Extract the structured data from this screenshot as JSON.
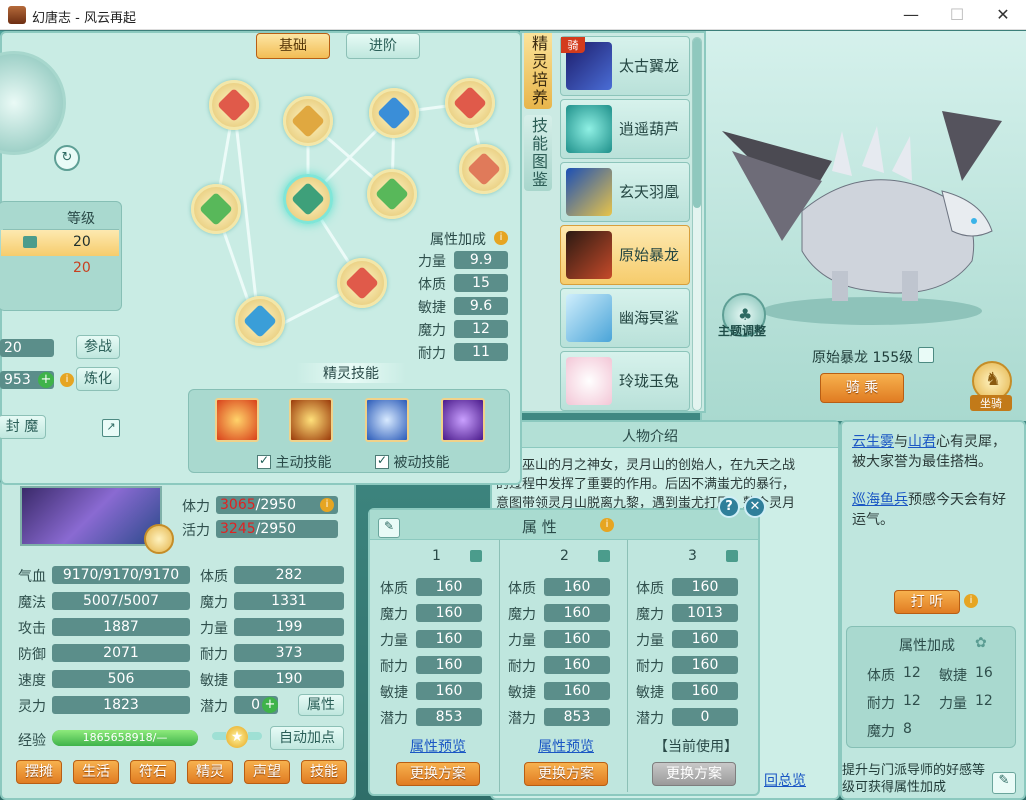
{
  "window": {
    "title": "幻唐志 - 风云再起",
    "min": "—",
    "max": "☐",
    "close": "✕"
  },
  "tabs": {
    "basic": "基础",
    "advanced": "进阶"
  },
  "vertical_tabs": {
    "spirit": "精灵培养",
    "skill_book": "技能图鉴",
    "ride_badge": "骑"
  },
  "left": {
    "level_header": "等级",
    "level_row1": "20",
    "level_row2": "20",
    "battle_value": "20",
    "battle_btn": "参战",
    "refine_value": "953",
    "refine_btn": "炼化",
    "magic_btn": "封 魔"
  },
  "spirit_attr": {
    "title": "属性加成",
    "rows": [
      {
        "label": "力量",
        "value": "9.9"
      },
      {
        "label": "体质",
        "value": "15"
      },
      {
        "label": "敏捷",
        "value": "9.6"
      },
      {
        "label": "魔力",
        "value": "12"
      },
      {
        "label": "耐力",
        "value": "11"
      }
    ]
  },
  "spirit_skills": {
    "title": "精灵技能",
    "active": "主动技能",
    "passive": "被动技能"
  },
  "pets": [
    {
      "name": "太古翼龙"
    },
    {
      "name": "逍遥葫芦"
    },
    {
      "name": "玄天羽凰"
    },
    {
      "name": "原始暴龙"
    },
    {
      "name": "幽海冥鲨"
    },
    {
      "name": "玲珑玉兔"
    }
  ],
  "mount": {
    "name_level": "原始暴龙 155级",
    "ride_btn": "骑 乘",
    "theme_btn": "主题调整",
    "mount_btn": "坐骑"
  },
  "char": {
    "stamina_label": "体力",
    "stamina_cur": "3065",
    "stamina_max": "/2950",
    "vigor_label": "活力",
    "vigor_cur": "3245",
    "vigor_max": "/2950",
    "stats_left": [
      {
        "label": "气血",
        "value": "9170/9170/9170"
      },
      {
        "label": "魔法",
        "value": "5007/5007"
      },
      {
        "label": "攻击",
        "value": "1887"
      },
      {
        "label": "防御",
        "value": "2071"
      },
      {
        "label": "速度",
        "value": "506"
      },
      {
        "label": "灵力",
        "value": "1823"
      }
    ],
    "stats_right": [
      {
        "label": "体质",
        "value": "282"
      },
      {
        "label": "魔力",
        "value": "1331"
      },
      {
        "label": "力量",
        "value": "199"
      },
      {
        "label": "耐力",
        "value": "373"
      },
      {
        "label": "敏捷",
        "value": "190"
      }
    ],
    "potential_label": "潜力",
    "potential_value": "0",
    "attr_btn": "属性",
    "exp_label": "经验",
    "exp_value": "1865658918/—",
    "exp_progress": 1.0,
    "auto_btn": "自动加点",
    "bottom_buttons": [
      "摆摊",
      "生活",
      "符石",
      "精灵",
      "声望",
      "技能"
    ]
  },
  "intro": {
    "title": "人物介绍",
    "text": "曾是巫山的月之神女，灵月山的创始人，在九天之战的过程中发挥了重要的作用。后因不满蚩尤的暴行，意图带领灵月山脱离九黎，遇到蚩尤打压，整个灵月山被迫避世……后世事。新振作"
  },
  "attr_panel": {
    "title": "属 性",
    "columns": [
      {
        "num": "1",
        "rows": [
          [
            "体质",
            "160"
          ],
          [
            "魔力",
            "160"
          ],
          [
            "力量",
            "160"
          ],
          [
            "耐力",
            "160"
          ],
          [
            "敏捷",
            "160"
          ],
          [
            "潜力",
            "853"
          ]
        ],
        "preview": "属性预览",
        "btn": "更换方案",
        "current": false
      },
      {
        "num": "2",
        "rows": [
          [
            "体质",
            "160"
          ],
          [
            "魔力",
            "160"
          ],
          [
            "力量",
            "160"
          ],
          [
            "耐力",
            "160"
          ],
          [
            "敏捷",
            "160"
          ],
          [
            "潜力",
            "853"
          ]
        ],
        "preview": "属性预览",
        "btn": "更换方案",
        "current": false
      },
      {
        "num": "3",
        "rows": [
          [
            "体质",
            "160"
          ],
          [
            "魔力",
            "1013"
          ],
          [
            "力量",
            "160"
          ],
          [
            "耐力",
            "160"
          ],
          [
            "敏捷",
            "160"
          ],
          [
            "潜力",
            "0"
          ]
        ],
        "preview": "【当前使用】",
        "btn": "更换方案",
        "current": true
      }
    ]
  },
  "news": {
    "p1_a": "云生雾",
    "p1_b": "与",
    "p1_c": "山君",
    "p1_d": "心有灵犀，被大家誉为最佳搭档。",
    "p2_a": "巡海鱼兵",
    "p2_b": "预感今天会有好运气。",
    "listen_btn": "打 听",
    "bonus_title": "属性加成",
    "bonus": [
      {
        "label": "体质",
        "value": "12"
      },
      {
        "label": "敏捷",
        "value": "16"
      },
      {
        "label": "耐力",
        "value": "12"
      },
      {
        "label": "力量",
        "value": "12"
      },
      {
        "label": "魔力",
        "value": "8"
      }
    ],
    "tip": "提升与门派导师的好感等级可获得属性加成",
    "overview_link": "回总览"
  }
}
